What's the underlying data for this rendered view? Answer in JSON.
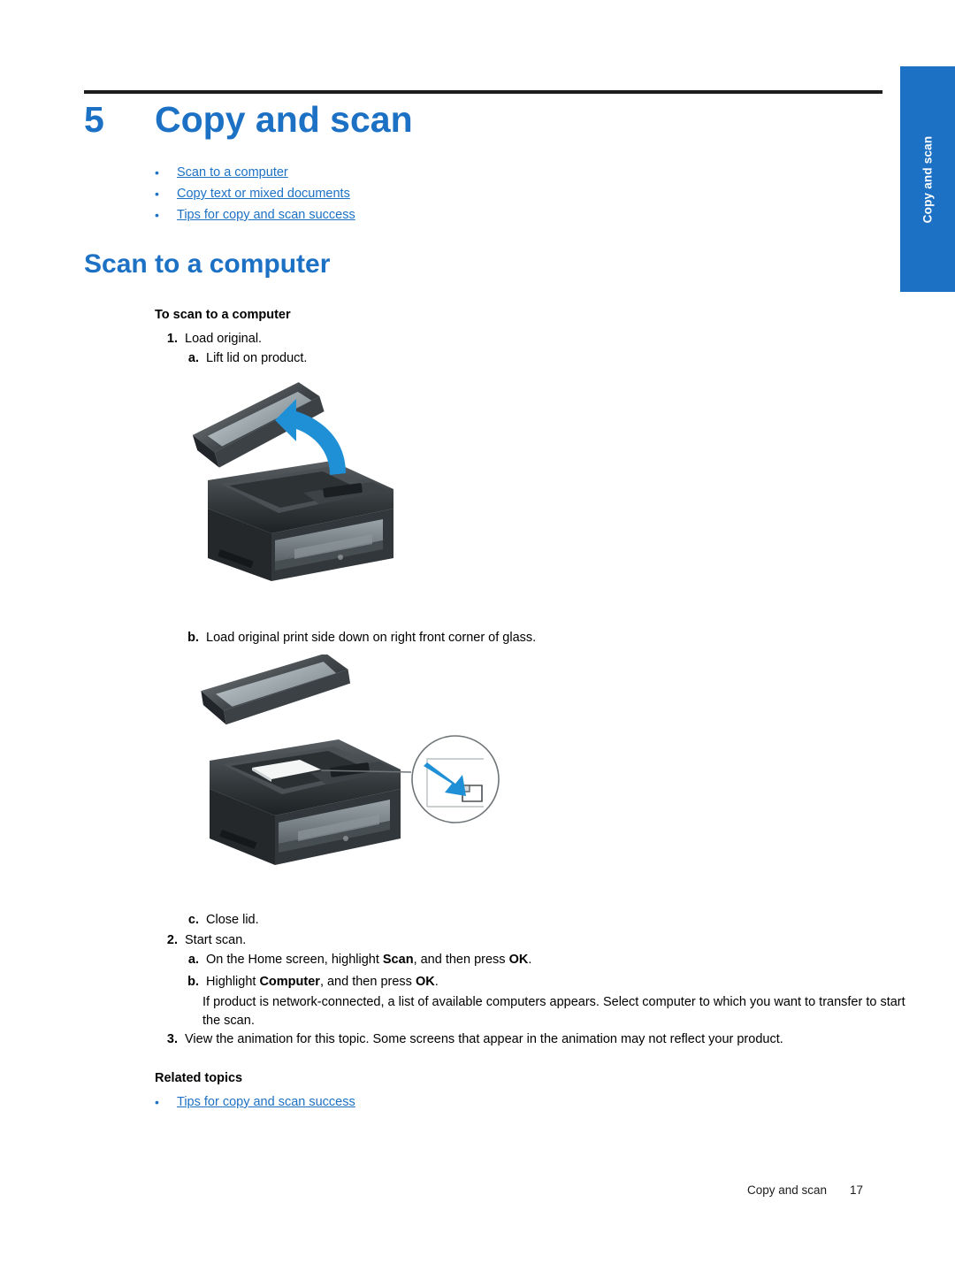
{
  "side_tab": {
    "label": "Copy and scan"
  },
  "chapter": {
    "number": "5",
    "title": "Copy and scan"
  },
  "toc": {
    "bullet": "•",
    "items": [
      {
        "label": "Scan to a computer"
      },
      {
        "label": "Copy text or mixed documents"
      },
      {
        "label": "Tips for copy and scan success"
      }
    ]
  },
  "section": {
    "title": "Scan to a computer"
  },
  "procedure": {
    "title": "To scan to a computer",
    "steps": [
      {
        "marker": "1.",
        "text": "Load original."
      },
      {
        "marker": "a.",
        "text": "Lift lid on product."
      },
      {
        "marker": "b.",
        "text": "Load original print side down on right front corner of glass."
      },
      {
        "marker": "c.",
        "text": "Close lid."
      },
      {
        "marker": "2.",
        "text": "Start scan."
      }
    ],
    "step2a": {
      "marker": "a.",
      "part1": "On the Home screen, highlight ",
      "bold1": "Scan",
      "part2": ", and then press ",
      "bold2": "OK",
      "part3": "."
    },
    "step2b": {
      "marker": "b.",
      "part1": "Highlight ",
      "bold1": "Computer",
      "part2": ", and then press ",
      "bold2": "OK",
      "part3": "."
    },
    "step2note": "If product is network-connected, a list of available computers appears. Select computer to which you want to transfer to start the scan.",
    "step3": {
      "marker": "3.",
      "text": "View the animation for this topic. Some screens that appear in the animation may not reflect your product."
    }
  },
  "related": {
    "title": "Related topics",
    "bullet": "•",
    "items": [
      {
        "label": "Tips for copy and scan success"
      }
    ]
  },
  "footer": {
    "text": "Copy and scan",
    "page": "17"
  },
  "colors": {
    "accent_blue": "#1c71c4",
    "tab_blue": "#1c71c4",
    "rule_black": "#1c1c1c"
  }
}
